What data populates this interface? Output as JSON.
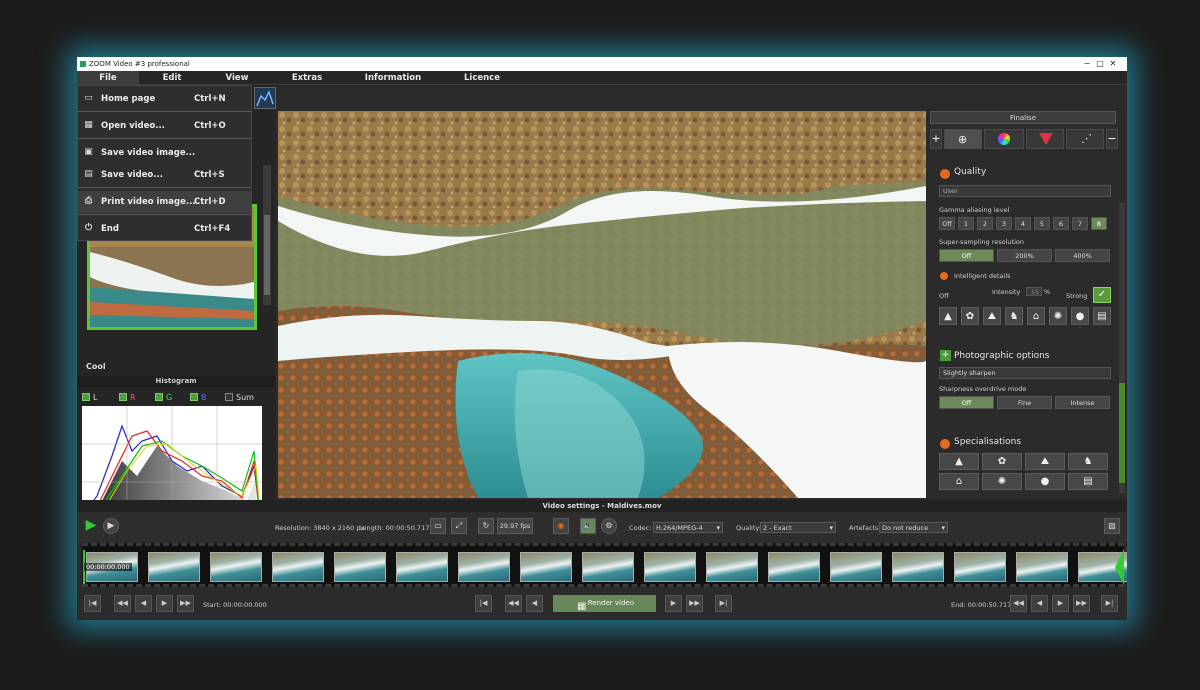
{
  "window": {
    "title": "ZOOM Video #3 professional",
    "controls": [
      "−",
      "□",
      "✕"
    ]
  },
  "menubar": {
    "items": [
      "File",
      "Edit",
      "View",
      "Extras",
      "Information",
      "Licence"
    ]
  },
  "file_menu": {
    "items": [
      {
        "label": "Home page",
        "shortcut": "Ctrl+N",
        "icon": "page-icon"
      },
      {
        "label": "Open video...",
        "shortcut": "Ctrl+O",
        "icon": "film-icon"
      },
      {
        "label": "Save video image...",
        "shortcut": "",
        "icon": "save-icon"
      },
      {
        "label": "Save video...",
        "shortcut": "Ctrl+S",
        "icon": "save-film-icon"
      },
      {
        "label": "Print video image...",
        "shortcut": "Ctrl+D",
        "icon": "printer-icon"
      },
      {
        "label": "End",
        "shortcut": "Ctrl+F4",
        "icon": "power-icon"
      }
    ]
  },
  "left_panel": {
    "preview_label": "Cool",
    "histogram_title": "Histogram",
    "channels": [
      "L",
      "R",
      "G",
      "B",
      "Sum"
    ]
  },
  "right_panel": {
    "finalise": "Finalise",
    "tools": [
      "+",
      "zoom-icon",
      "color-wheel-icon",
      "rgb-triangle-icon",
      "share-nodes-icon",
      "−"
    ],
    "quality": {
      "title": "Quality",
      "preset": "User",
      "gamma_label": "Gamma aliasing level",
      "gamma_levels": [
        "Off",
        "1",
        "2",
        "3",
        "4",
        "5",
        "6",
        "7",
        "8"
      ],
      "gamma_selected": "8",
      "supersampling_label": "Super-sampling resolution",
      "supersampling": [
        "Off",
        "200%",
        "400%"
      ],
      "supersampling_selected": "Off",
      "intelligent_label": "Intelligent details",
      "intensity_off": "Off",
      "intensity_label": "Intensity",
      "intensity_value": "15",
      "intensity_unit": "%",
      "intensity_strong": "Strong",
      "detail_icons": [
        "mountain-icon",
        "plant-icon",
        "hills-icon",
        "horse-icon",
        "house-icon",
        "bulb-gear-icon",
        "person-icon",
        "document-icon"
      ]
    },
    "photographic": {
      "title": "Photographic options",
      "preset": "Slightly sharpen",
      "overdrive_label": "Sharpness overdrive mode",
      "overdrive": [
        "Off",
        "Fine",
        "Intense"
      ],
      "overdrive_selected": "Off"
    },
    "specialisations": {
      "title": "Specialisations",
      "icons": [
        "mountain-icon",
        "plant-icon",
        "hills-icon",
        "horse-icon",
        "house-icon",
        "bulb-gear-icon",
        "person-icon",
        "document-icon"
      ]
    }
  },
  "video_settings": {
    "title": "Video settings - Maldives.mov",
    "resolution": "Resolution: 3840 x 2160 px",
    "length": "Length: 00:00:50.717",
    "fps": "29,97 fps",
    "codec_label": "Codec:",
    "codec": "H.264/MPEG-4",
    "quality_label": "Quality:",
    "quality": "2 - Exact",
    "artefacts_label": "Artefacts:",
    "artefacts": "Do not reduce"
  },
  "timeline": {
    "timestamp": "00:00:00.000"
  },
  "bottom": {
    "start": "Start: 00:00:00.000",
    "end": "End: 00:00:50.717",
    "render": "Render video"
  },
  "colors": {
    "accent_green": "#5ec62e",
    "render_button": "#6a8759",
    "glow": "#28bee6"
  }
}
